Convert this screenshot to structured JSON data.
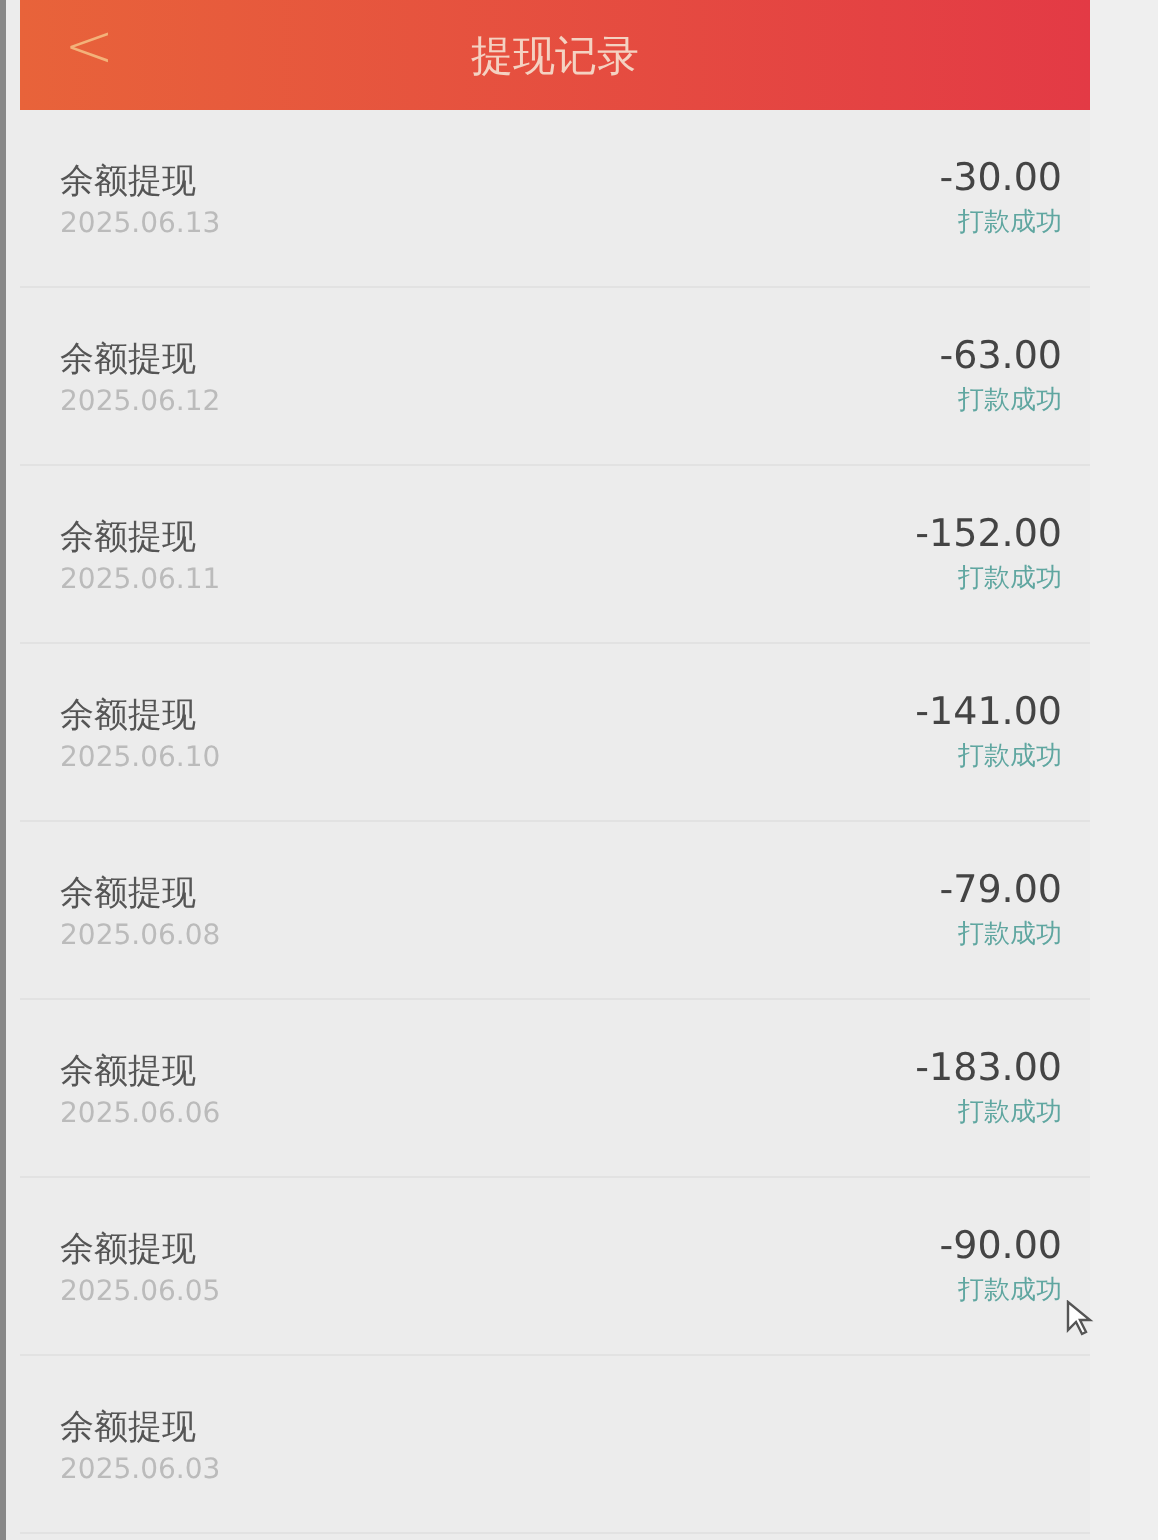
{
  "header": {
    "back": "<",
    "title": "提现记录"
  },
  "records": [
    {
      "title": "余额提现",
      "date": "2025.06.13",
      "amount": "-30.00",
      "status": "打款成功"
    },
    {
      "title": "余额提现",
      "date": "2025.06.12",
      "amount": "-63.00",
      "status": "打款成功"
    },
    {
      "title": "余额提现",
      "date": "2025.06.11",
      "amount": "-152.00",
      "status": "打款成功"
    },
    {
      "title": "余额提现",
      "date": "2025.06.10",
      "amount": "-141.00",
      "status": "打款成功"
    },
    {
      "title": "余额提现",
      "date": "2025.06.08",
      "amount": "-79.00",
      "status": "打款成功"
    },
    {
      "title": "余额提现",
      "date": "2025.06.06",
      "amount": "-183.00",
      "status": "打款成功"
    },
    {
      "title": "余额提现",
      "date": "2025.06.05",
      "amount": "-90.00",
      "status": "打款成功"
    },
    {
      "title": "余额提现",
      "date": "2025.06.03"
    }
  ]
}
